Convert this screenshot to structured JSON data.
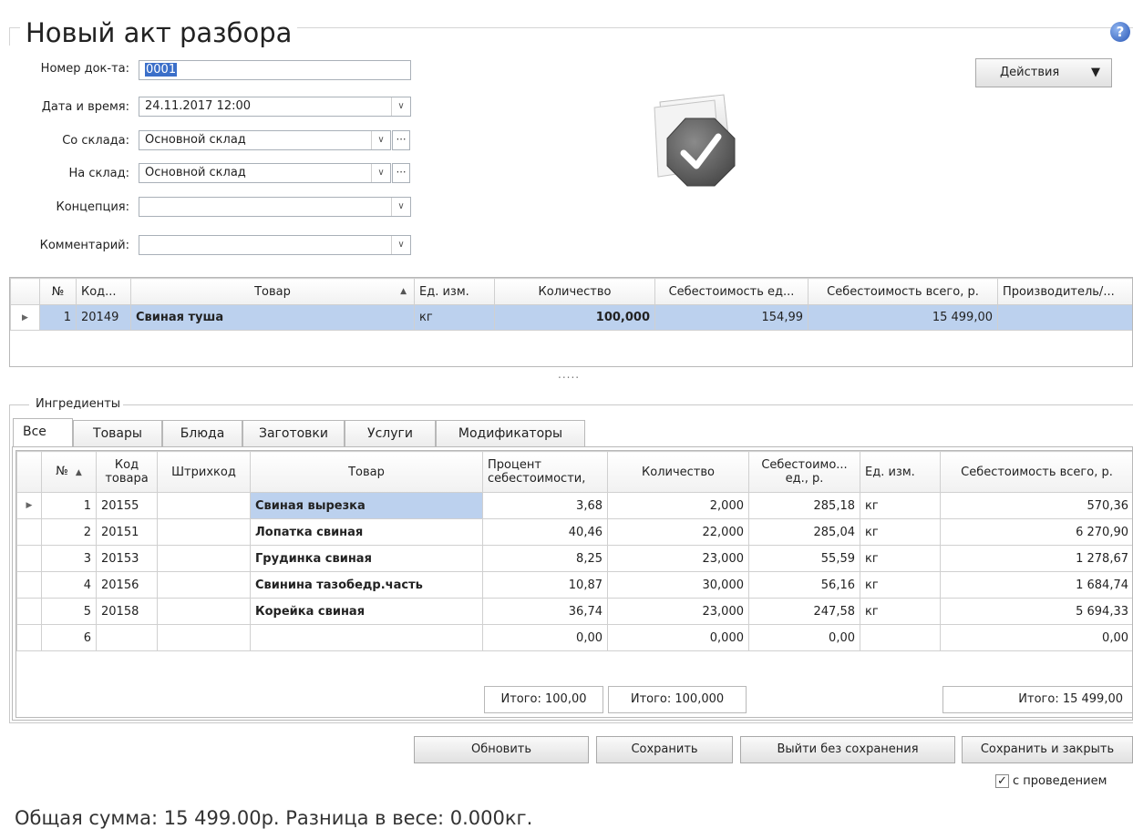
{
  "window": {
    "title": "Новый акт разбора",
    "help_glyph": "?"
  },
  "form": {
    "doc_number": {
      "label": "Номер док-та:",
      "value": "0001"
    },
    "datetime": {
      "label": "Дата и время:",
      "value": "24.11.2017 12:00"
    },
    "from_store": {
      "label": "Со склада:",
      "value": "Основной склад"
    },
    "to_store": {
      "label": "На склад:",
      "value": "Основной склад"
    },
    "concept": {
      "label": "Концепция:",
      "value": ""
    },
    "comment": {
      "label": "Комментарий:",
      "value": ""
    }
  },
  "actions_button": "Действия",
  "status_icon": "document-approved-icon",
  "main_table": {
    "headers": [
      "№",
      "Код...",
      "Товар",
      "Ед. изм.",
      "Количество",
      "Себестоимость ед...",
      "Себестоимость всего, р.",
      "Производитель/..."
    ],
    "rows": [
      {
        "num": "1",
        "code": "20149",
        "product": "Свиная туша",
        "unit": "кг",
        "qty": "100,000",
        "unit_cost": "154,99",
        "total_cost": "15 499,00",
        "maker": ""
      }
    ]
  },
  "splitter_glyph": ".....",
  "ingredients": {
    "group_label": "Ингредиенты",
    "tabs": [
      "Все",
      "Товары",
      "Блюда",
      "Заготовки",
      "Услуги",
      "Модификаторы"
    ],
    "headers": {
      "num": "№",
      "code_1": "Код",
      "code_2": "товара",
      "barcode": "Штрихкод",
      "product": "Товар",
      "percent_1": "Процент",
      "percent_2": "себестоимости,",
      "qty": "Количество",
      "unit_cost_1": "Себестоимо...",
      "unit_cost_2": "ед., р.",
      "unit": "Ед. изм.",
      "total": "Себестоимость всего, р."
    },
    "rows": [
      {
        "num": "1",
        "code": "20155",
        "barcode": "",
        "product": "Свиная вырезка",
        "percent": "3,68",
        "qty": "2,000",
        "unit_cost": "285,18",
        "unit": "кг",
        "total": "570,36"
      },
      {
        "num": "2",
        "code": "20151",
        "barcode": "",
        "product": "Лопатка свиная",
        "percent": "40,46",
        "qty": "22,000",
        "unit_cost": "285,04",
        "unit": "кг",
        "total": "6 270,90"
      },
      {
        "num": "3",
        "code": "20153",
        "barcode": "",
        "product": "Грудинка свиная",
        "percent": "8,25",
        "qty": "23,000",
        "unit_cost": "55,59",
        "unit": "кг",
        "total": "1 278,67"
      },
      {
        "num": "4",
        "code": "20156",
        "barcode": "",
        "product": "Свинина тазобедр.часть",
        "percent": "10,87",
        "qty": "30,000",
        "unit_cost": "56,16",
        "unit": "кг",
        "total": "1 684,74"
      },
      {
        "num": "5",
        "code": "20158",
        "barcode": "",
        "product": "Корейка свиная",
        "percent": "36,74",
        "qty": "23,000",
        "unit_cost": "247,58",
        "unit": "кг",
        "total": "5 694,33"
      },
      {
        "num": "6",
        "code": "",
        "barcode": "",
        "product": "",
        "percent": "0,00",
        "qty": "0,000",
        "unit_cost": "0,00",
        "unit": "",
        "total": "0,00"
      }
    ],
    "totals": {
      "percent": "Итого: 100,00",
      "qty": "Итого: 100,000",
      "cost": "Итого: 15 499,00"
    }
  },
  "buttons": {
    "refresh": "Обновить",
    "save": "Сохранить",
    "exit": "Выйти без сохранения",
    "save_close": "Сохранить и закрыть"
  },
  "post_checkbox": {
    "label": "с проведением",
    "checked": true
  },
  "footer_summary": "Общая сумма: 15 499.00р. Разница в весе: 0.000кг."
}
